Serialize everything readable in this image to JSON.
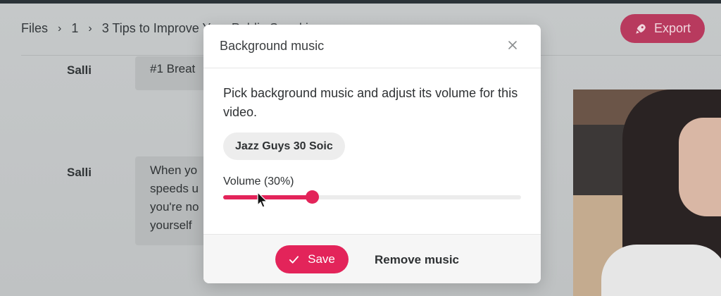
{
  "breadcrumb": {
    "items": [
      "Files",
      "1",
      "3 Tips to Improve Your Public Speaking"
    ],
    "separator": "›"
  },
  "header": {
    "export_label": "Export",
    "export_icon": "rocket-icon"
  },
  "transcript": {
    "rows": [
      {
        "speaker": "Salli",
        "text": "#1 Breat"
      },
      {
        "speaker": "Salli",
        "text_lines": [
          "When yo",
          "speeds u",
          "you're no",
          "yourself"
        ]
      }
    ]
  },
  "modal": {
    "title": "Background music",
    "close_icon": "close-icon",
    "description": "Pick background music and adjust its volume for this video.",
    "selected_music": "Jazz Guys 30 Soic",
    "volume_label": "Volume (30%)",
    "volume_fraction": 0.3,
    "save_label": "Save",
    "save_icon": "check-icon",
    "remove_label": "Remove music"
  },
  "colors": {
    "accent": "#e3245a",
    "export_button_dimmed": "#b83a5e"
  }
}
